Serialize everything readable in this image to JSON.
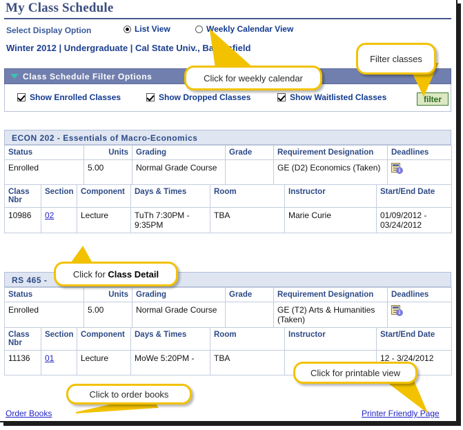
{
  "page": {
    "title": "My Class Schedule"
  },
  "display_option": {
    "label": "Select Display Option",
    "options": [
      {
        "label": "List View",
        "selected": true
      },
      {
        "label": "Weekly Calendar View",
        "selected": false
      }
    ]
  },
  "term_line": "Winter 2012 | Undergraduate | Cal State Univ., Bakersfield",
  "filter_panel": {
    "title": "Class Schedule Filter Options",
    "collapse_icon": "triangle-down-icon",
    "checkboxes": [
      {
        "label": "Show Enrolled Classes",
        "checked": true
      },
      {
        "label": "Show Dropped Classes",
        "checked": true
      },
      {
        "label": "Show Waitlisted Classes",
        "checked": true
      }
    ],
    "filter_button": "filter"
  },
  "courses": [
    {
      "header": "ECON 202 - Essentials of Macro-Economics",
      "summary_headers": [
        "Status",
        "Units",
        "Grading",
        "Grade",
        "Requirement Designation",
        "Deadlines"
      ],
      "summary_row": {
        "status": "Enrolled",
        "units": "5.00",
        "grading": "Normal Grade Course",
        "grade": "",
        "requirement_designation": "GE (D2) Economics (Taken)",
        "deadlines_icon": "deadlines-calendar-info-icon"
      },
      "detail_headers": [
        "Class Nbr",
        "Section",
        "Component",
        "Days & Times",
        "Room",
        "Instructor",
        "Start/End Date"
      ],
      "detail_row": {
        "class_nbr": "10986",
        "section": "02",
        "component": "Lecture",
        "days_times": "TuTh 7:30PM - 9:35PM",
        "room": "TBA",
        "instructor": "Marie Curie",
        "start_end_date": "01/09/2012 - 03/24/2012"
      }
    },
    {
      "header": "RS 465 -",
      "summary_headers": [
        "Status",
        "Units",
        "Grading",
        "Grade",
        "Requirement Designation",
        "Deadlines"
      ],
      "summary_row": {
        "status": "Enrolled",
        "units": "5.00",
        "grading": "Normal Grade Course",
        "grade": "",
        "requirement_designation": "GE (T2) Arts & Humanities (Taken)",
        "deadlines_icon": "deadlines-calendar-info-icon"
      },
      "detail_headers": [
        "Class Nbr",
        "Section",
        "Component",
        "Days & Times",
        "Room",
        "Instructor",
        "Start/End Date"
      ],
      "detail_row": {
        "class_nbr": "11136",
        "section": "01",
        "component": "Lecture",
        "days_times": "MoWe 5:20PM -",
        "room": "TBA",
        "instructor": "",
        "start_end_date": "12 - 3/24/2012"
      }
    }
  ],
  "footer": {
    "order_books": "Order Books",
    "printer_friendly": "Printer Friendly Page"
  },
  "callouts": {
    "weekly_calendar": "Click for weekly calendar",
    "filter_classes": "Filter classes",
    "class_detail_pre": "Click for ",
    "class_detail_bold": "Class Detail",
    "printable_view": "Click for printable view",
    "order_books": "Click to order books"
  },
  "colors": {
    "title_navy": "#3b4d7f",
    "bar_blue": "#717fae",
    "course_head_blue": "#dfe6f2",
    "link_blue": "#2323c8",
    "callout_border": "#f2c200",
    "filter_green_bg": "#dbe8c2",
    "filter_green_text": "#2e6b23",
    "collapse_teal": "#3ec0b0"
  }
}
